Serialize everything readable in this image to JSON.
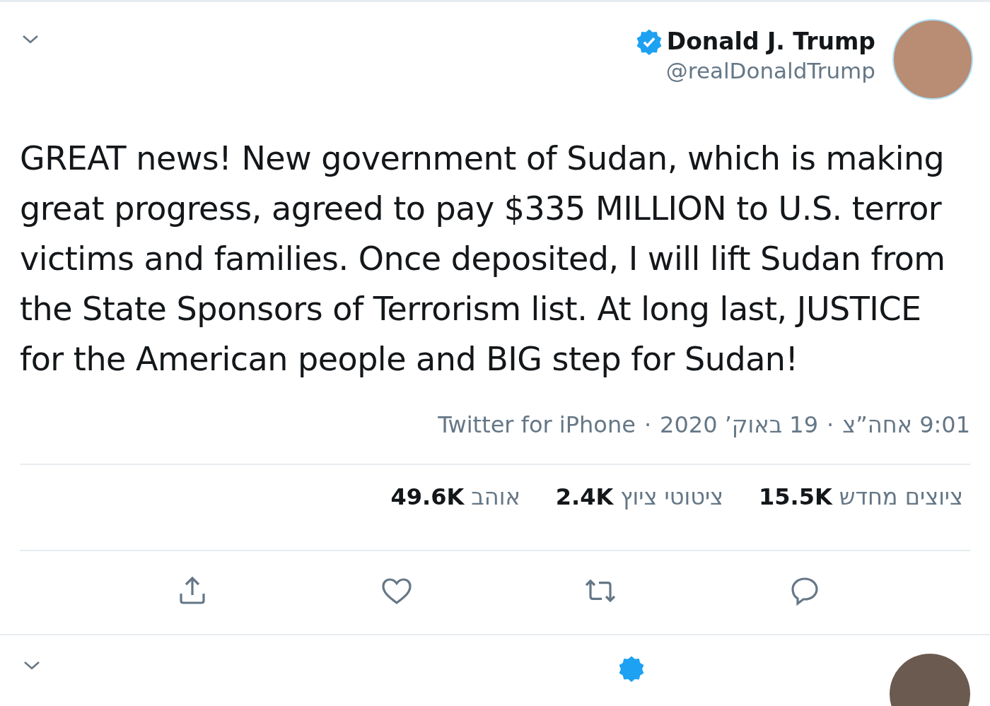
{
  "tweet": {
    "author": {
      "name": "Donald J. Trump",
      "handle": "@realDonaldTrump",
      "verified": true
    },
    "text": "GREAT news! New government of Sudan, which is making great progress, agreed to pay $335 MILLION to U.S. terror victims and families. Once deposited, I will lift Sudan from the State Sponsors of Terrorism list. At long last, JUSTICE for the American people and BIG step for Sudan!",
    "meta": [
      "9:01 אחה”צ",
      "·",
      "19 באוק’ 2020",
      "·",
      "Twitter for iPhone"
    ],
    "stats": [
      {
        "count": "15.5K",
        "label": "ציוצים מחדש"
      },
      {
        "count": "2.4K",
        "label": "ציטוטי ציוץ"
      },
      {
        "count": "49.6K",
        "label": "אוהב"
      }
    ]
  },
  "next_tweet": {
    "verified": true
  }
}
